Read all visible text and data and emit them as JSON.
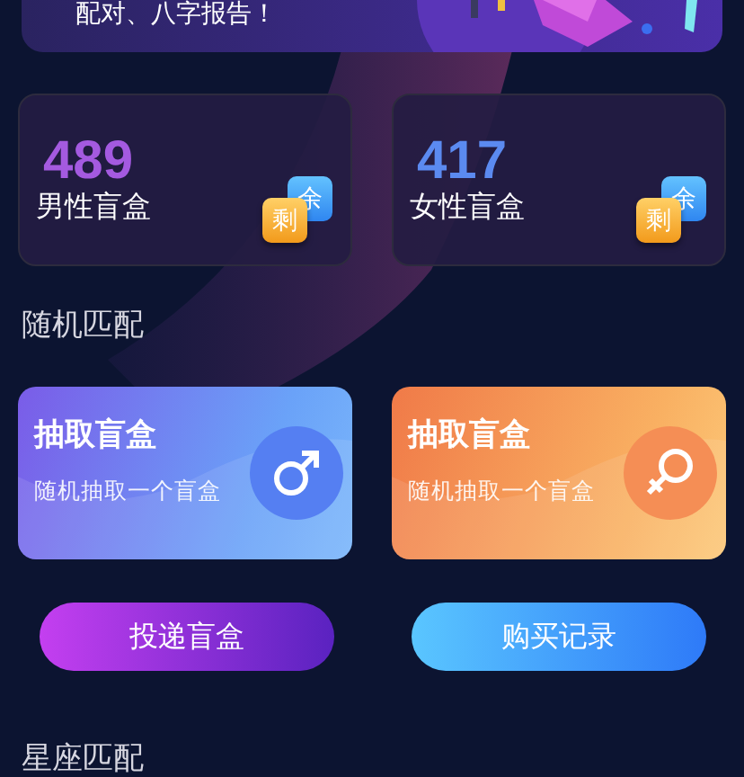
{
  "banner": {
    "text": "配对、八字报告！",
    "kind": "picture"
  },
  "stock": [
    {
      "count": "489",
      "label": "男性盲盒",
      "badges": [
        "余",
        "剩"
      ],
      "color": "#a45ae0"
    },
    {
      "count": "417",
      "label": "女性盲盒",
      "badges": [
        "余",
        "剩"
      ],
      "color": "#5b8af0"
    }
  ],
  "random_match": {
    "title": "随机匹配",
    "cards": [
      {
        "kind": "male",
        "title": "抽取盲盒",
        "subtitle": "随机抽取一个盲盒"
      },
      {
        "kind": "female",
        "title": "抽取盲盒",
        "subtitle": "随机抽取一个盲盒"
      }
    ]
  },
  "buttons": [
    {
      "kind": "purple",
      "label": "投递盲盒"
    },
    {
      "kind": "blue",
      "label": "购买记录"
    }
  ],
  "constellation_match": {
    "title": "星座匹配"
  }
}
